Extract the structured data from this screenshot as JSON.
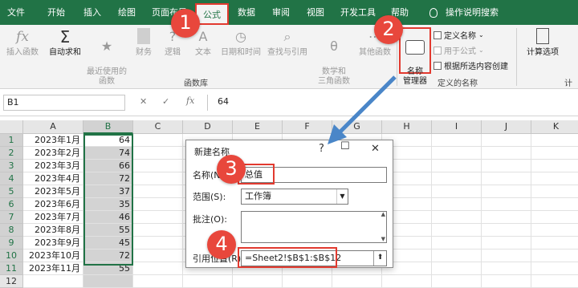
{
  "ribbon_tabs": [
    "文件",
    "开始",
    "插入",
    "绘图",
    "页面布局",
    "公式",
    "数据",
    "审阅",
    "视图",
    "开发工具",
    "帮助"
  ],
  "active_tab": "公式",
  "tell_me": "操作说明搜索",
  "function_library": {
    "buttons": [
      "插入函数",
      "自动求和",
      "最近使用的\n函数",
      "财务",
      "逻辑",
      "文本",
      "日期和时间",
      "查找与引用",
      "数学和\n三角函数",
      "其他函数"
    ],
    "group_label": "函数库"
  },
  "defined_names": {
    "name_manager": "名称\n管理器",
    "define_name": "定义名称",
    "use_in_formula": "用于公式",
    "create_from_selection": "根据所选内容创建",
    "group_label": "定义的名称"
  },
  "calculation": {
    "options": "计算选项",
    "group_label_partial": "计"
  },
  "formula_bar": {
    "name_box": "B1",
    "formula": "64",
    "fx": "fx"
  },
  "columns": [
    "A",
    "B",
    "C",
    "D",
    "E",
    "F",
    "G",
    "H",
    "I",
    "J",
    "K"
  ],
  "rows": [
    {
      "num": "1",
      "a": "2023年1月",
      "b": "64"
    },
    {
      "num": "2",
      "a": "2023年2月",
      "b": "74"
    },
    {
      "num": "3",
      "a": "2023年3月",
      "b": "66"
    },
    {
      "num": "4",
      "a": "2023年4月",
      "b": "72"
    },
    {
      "num": "5",
      "a": "2023年5月",
      "b": "37"
    },
    {
      "num": "6",
      "a": "2023年6月",
      "b": "35"
    },
    {
      "num": "7",
      "a": "2023年7月",
      "b": "46"
    },
    {
      "num": "8",
      "a": "2023年8月",
      "b": "55"
    },
    {
      "num": "9",
      "a": "2023年9月",
      "b": "45"
    },
    {
      "num": "10",
      "a": "2023年10月",
      "b": "72"
    },
    {
      "num": "11",
      "a": "2023年11月",
      "b": "55"
    },
    {
      "num": "12",
      "a": "",
      "b": ""
    }
  ],
  "dialog": {
    "title": "新建名称",
    "name_label": "名称(N):",
    "name_value": "总值",
    "scope_label": "范围(S):",
    "scope_value": "工作簿",
    "comment_label": "批注(O):",
    "refers_label": "引用位置(R):",
    "refers_value": "=Sheet2!$B$1:$B$12"
  },
  "callouts": [
    "1",
    "2",
    "3",
    "4"
  ],
  "colors": {
    "excel_green": "#217346",
    "callout_red": "#e8473c",
    "highlight_red": "#e23a2f",
    "arrow_blue": "#4a86c8"
  }
}
